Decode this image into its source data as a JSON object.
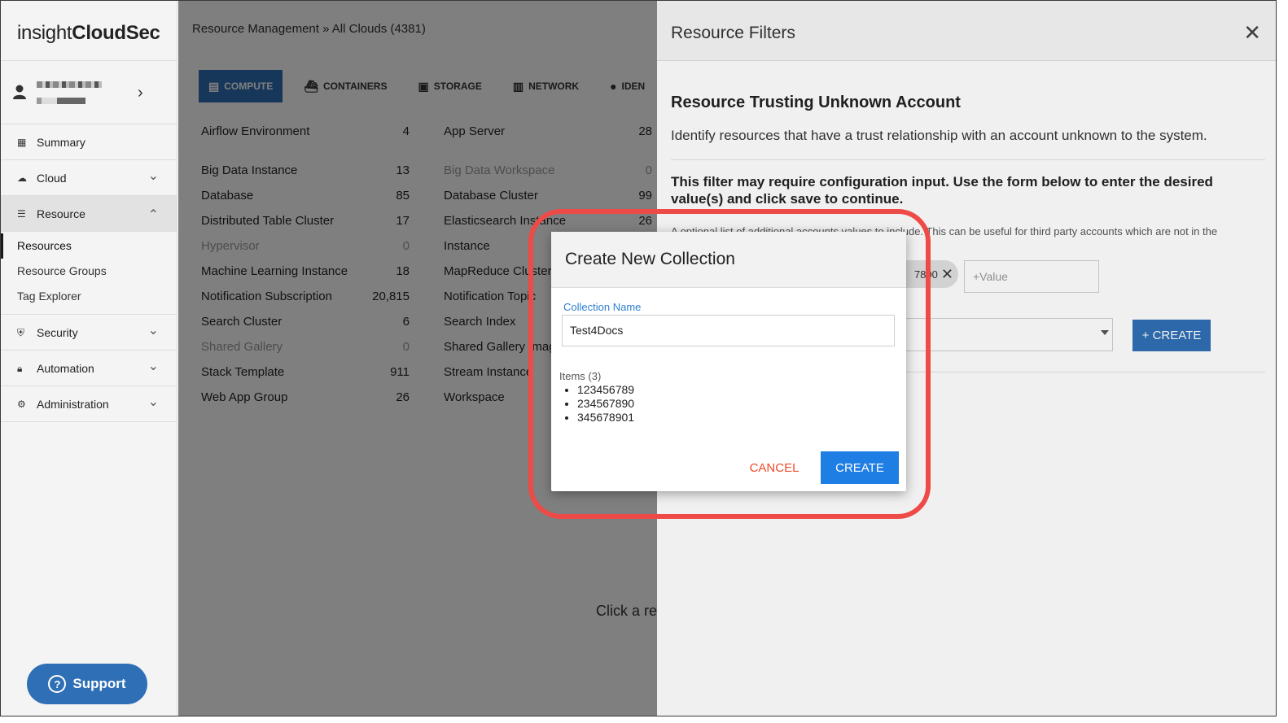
{
  "app": {
    "logo_light": "insight",
    "logo_bold": "CloudSec"
  },
  "sidebar": {
    "items": [
      {
        "label": "Summary",
        "icon": "dashboard-icon"
      },
      {
        "label": "Cloud",
        "icon": "cloud-icon"
      },
      {
        "label": "Resource",
        "icon": "list-icon"
      },
      {
        "label": "Security",
        "icon": "shield-icon"
      },
      {
        "label": "Automation",
        "icon": "lock-icon"
      },
      {
        "label": "Administration",
        "icon": "gear-icon"
      }
    ],
    "resource_sub": [
      "Resources",
      "Resource Groups",
      "Tag Explorer"
    ],
    "support_label": "Support"
  },
  "main": {
    "breadcrumb": "Resource Management » All Clouds (4381)",
    "tabs": [
      "COMPUTE",
      "CONTAINERS",
      "STORAGE",
      "NETWORK",
      "IDEN"
    ],
    "left_resources": [
      {
        "name": "Airflow Environment",
        "count": "4"
      },
      {
        "name": "Big Data Instance",
        "count": "13"
      },
      {
        "name": "Database",
        "count": "85"
      },
      {
        "name": "Distributed Table Cluster",
        "count": "17"
      },
      {
        "name": "Hypervisor",
        "count": "0"
      },
      {
        "name": "Machine Learning Instance",
        "count": "18"
      },
      {
        "name": "Notification Subscription",
        "count": "20,815"
      },
      {
        "name": "Search Cluster",
        "count": "6"
      },
      {
        "name": "Shared Gallery",
        "count": "0"
      },
      {
        "name": "Stack Template",
        "count": "911"
      },
      {
        "name": "Web App Group",
        "count": "26"
      }
    ],
    "right_resources": [
      {
        "name": "App Server",
        "count": "28"
      },
      {
        "name": "Big Data Workspace",
        "count": "0"
      },
      {
        "name": "Database Cluster",
        "count": "99"
      },
      {
        "name": "Elasticsearch Instance",
        "count": "26"
      },
      {
        "name": "Instance",
        "count": ""
      },
      {
        "name": "MapReduce Cluster",
        "count": ""
      },
      {
        "name": "Notification Topic",
        "count": ""
      },
      {
        "name": "Search Index",
        "count": ""
      },
      {
        "name": "Shared Gallery Image",
        "count": ""
      },
      {
        "name": "Stream Instance",
        "count": ""
      },
      {
        "name": "Workspace",
        "count": ""
      }
    ],
    "click_hint": "Click a res"
  },
  "panel": {
    "title": "Resource Filters",
    "filter_title": "Resource Trusting Unknown Account",
    "filter_desc": "Identify resources that have a trust relationship with an account unknown to the system.",
    "note": "This filter may require configuration input. Use the form below to enter the desired value(s) and click save to continue.",
    "small_text": "A optional list of additional accounts values to include. This can be useful for third party accounts which are not in the",
    "chip_text": "7890",
    "value_placeholder": "+Value",
    "create_label": "+ CREATE"
  },
  "modal": {
    "title": "Create New Collection",
    "name_label": "Collection Name",
    "name_value": "Test4Docs",
    "items_title": "Items (3)",
    "items": [
      "123456789",
      "234567890",
      "345678901"
    ],
    "cancel_label": "CANCEL",
    "create_label": "CREATE"
  },
  "colors": {
    "accent": "#2f6fb5",
    "highlight": "#ee4a47",
    "cancel": "#ef4a2a"
  }
}
